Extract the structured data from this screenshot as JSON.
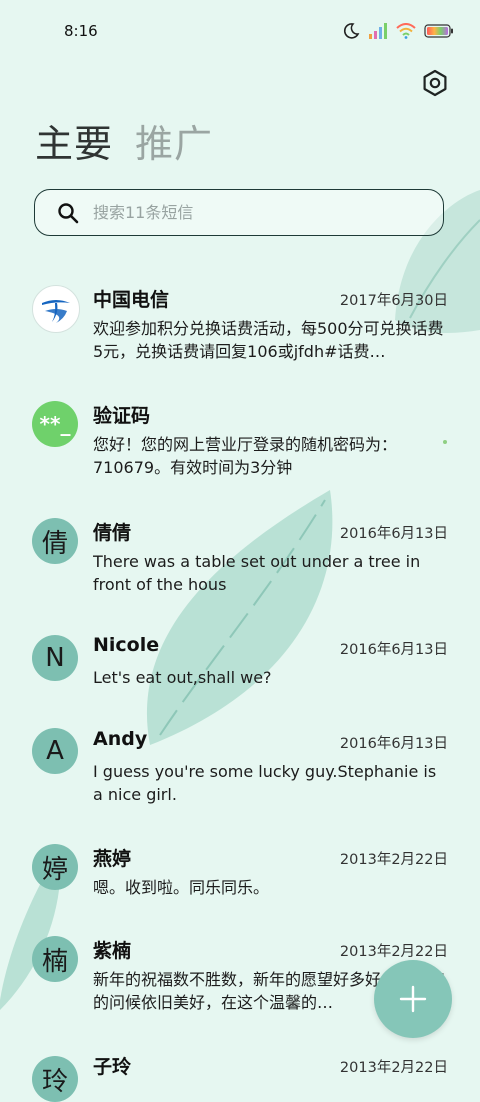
{
  "status": {
    "time": "8:16"
  },
  "tabs": {
    "primary": "主要",
    "promo": "推广"
  },
  "search": {
    "placeholder": "搜索11条短信"
  },
  "conversations": [
    {
      "name": "中国电信",
      "date": "2017年6月30日",
      "preview": "欢迎参加积分兑换话费活动，每500分可兑换话费5元，兑换话费请回复106或jfdh#话费…",
      "avatar": "telecom-logo"
    },
    {
      "name": "验证码",
      "date": "",
      "preview": "您好！您的网上营业厅登录的随机密码为：710679。有效时间为3分钟",
      "avatar_text": "**_"
    },
    {
      "name": "倩倩",
      "date": "2016年6月13日",
      "preview": "There was a table set out under a tree in front of the hous",
      "avatar_text": "倩"
    },
    {
      "name": "Nicole",
      "date": "2016年6月13日",
      "preview": "Let's eat out,shall we?",
      "avatar_text": "N"
    },
    {
      "name": "Andy",
      "date": "2016年6月13日",
      "preview": "I guess you're some lucky guy.Stephanie is a nice girl.",
      "avatar_text": "A"
    },
    {
      "name": "燕婷",
      "date": "2013年2月22日",
      "preview": "嗯。收到啦。同乐同乐。",
      "avatar_text": "婷"
    },
    {
      "name": "紫楠",
      "date": "2013年2月22日",
      "preview": "新年的祝福数不胜数，新年的愿望好多好多，新年的问候依旧美好，在这个温馨的…",
      "avatar_text": "楠"
    },
    {
      "name": "子玲",
      "date": "2013年2月22日",
      "preview": "",
      "avatar_text": "玲"
    }
  ],
  "colors": {
    "background": "#e6f7f1",
    "accent": "#85c6b8",
    "avatar": "#7dbfb1"
  },
  "icons": [
    "moon-icon",
    "signal-icon",
    "wifi-icon",
    "battery-icon",
    "settings-icon",
    "search-icon",
    "add-icon"
  ]
}
